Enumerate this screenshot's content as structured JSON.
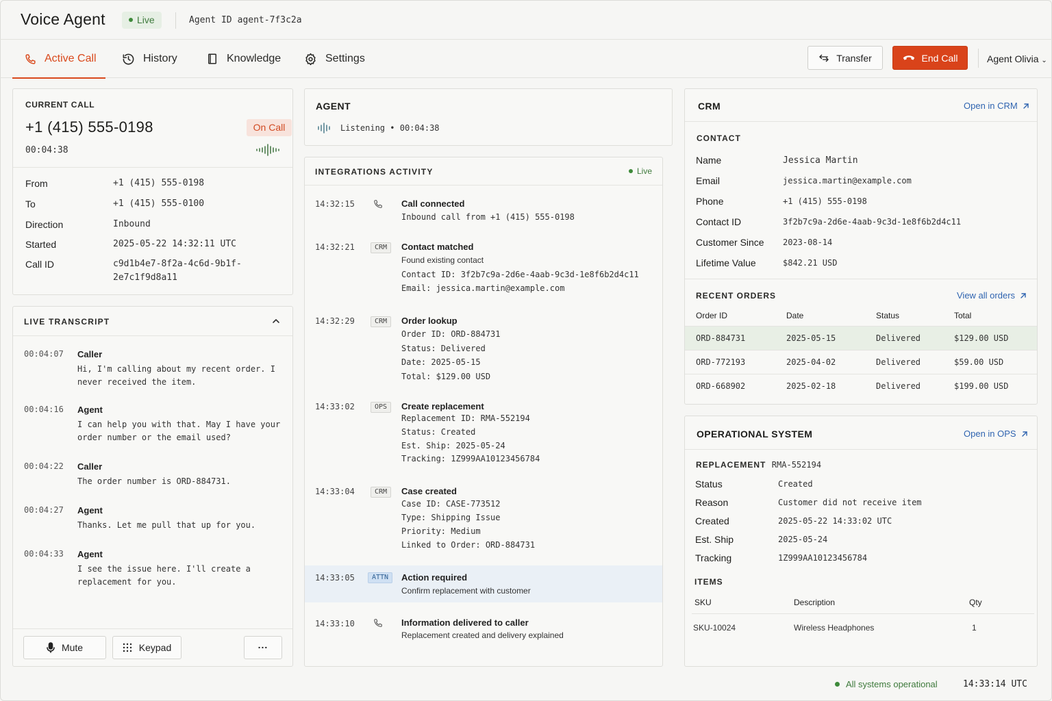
{
  "header": {
    "title": "Voice Agent",
    "live_label": "Live",
    "agent_id_label": "Agent ID",
    "agent_id": "agent-7f3c2a"
  },
  "nav": {
    "tabs": [
      {
        "label": "Active Call",
        "icon": "phone-icon",
        "active": true
      },
      {
        "label": "History",
        "icon": "history-icon"
      },
      {
        "label": "Knowledge",
        "icon": "book-icon"
      },
      {
        "label": "Settings",
        "icon": "gear-icon"
      }
    ],
    "transfer_label": "Transfer",
    "end_call_label": "End Call",
    "user_label": "Agent Olivia"
  },
  "current_call": {
    "section_label": "CURRENT CALL",
    "number": "+1 (415) 555-0198",
    "status": "On Call",
    "timer": "00:04:38",
    "fields": [
      {
        "key": "From",
        "value": "+1 (415) 555-0198"
      },
      {
        "key": "To",
        "value": "+1 (415) 555-0100"
      },
      {
        "key": "Direction",
        "value": "Inbound"
      },
      {
        "key": "Started",
        "value": "2025-05-22 14:32:11 UTC"
      },
      {
        "key": "Call ID",
        "value": "c9d1b4e7-8f2a-4c6d-9b1f-",
        "value2": "2e7c1f9d8a11"
      }
    ]
  },
  "transcript": {
    "section_label": "LIVE TRANSCRIPT",
    "entries": [
      {
        "time": "00:04:07",
        "speaker": "Caller",
        "text": "Hi, I'm calling about my recent order. I never received the item."
      },
      {
        "time": "00:04:16",
        "speaker": "Agent",
        "text": "I can help you with that. May I have your order number or the email used?"
      },
      {
        "time": "00:04:22",
        "speaker": "Caller",
        "text": "The order number is ORD-884731."
      },
      {
        "time": "00:04:27",
        "speaker": "Agent",
        "text": "Thanks. Let me pull that up for you."
      },
      {
        "time": "00:04:33",
        "speaker": "Agent",
        "text": "I see the issue here. I'll create a replacement for you."
      }
    ],
    "mute_label": "Mute",
    "keypad_label": "Keypad",
    "more_label": "..."
  },
  "agent": {
    "section_label": "AGENT",
    "state": "Listening",
    "separator": "•",
    "timer": "00:04:38"
  },
  "activity": {
    "section_label": "INTEGRATIONS ACTIVITY",
    "live_label": "Live",
    "items": [
      {
        "time": "14:32:15",
        "badge": "",
        "icon": "phone-icon",
        "title": "Call connected",
        "lines": [
          "Inbound call from +1 (415) 555-0198"
        ]
      },
      {
        "time": "14:32:21",
        "badge": "CRM",
        "title": "Contact matched",
        "lines": [
          "Found existing contact",
          "Contact ID:  3f2b7c9a-2d6e-4aab-9c3d-1e8f6b2d4c11",
          "Email:  jessica.martin@example.com"
        ]
      },
      {
        "time": "14:32:29",
        "badge": "CRM",
        "title": "Order lookup",
        "lines": [
          "Order ID:  ORD-884731",
          "Status:  Delivered",
          "Date:  2025-05-15",
          "Total:  $129.00 USD"
        ]
      },
      {
        "time": "14:33:02",
        "badge": "OPS",
        "title": "Create replacement",
        "lines": [
          "Replacement ID:  RMA-552194",
          "Status:  Created",
          "Est. Ship:  2025-05-24",
          "Tracking:  1Z999AA10123456784"
        ]
      },
      {
        "time": "14:33:04",
        "badge": "CRM",
        "title": "Case created",
        "lines": [
          "Case ID:  CASE-773512",
          "Type:  Shipping Issue",
          "Priority:  Medium",
          "Linked to Order:  ORD-884731"
        ]
      },
      {
        "time": "14:33:05",
        "badge": "ATTN",
        "title": "Action required",
        "lines": [
          "Confirm replacement with customer"
        ]
      },
      {
        "time": "14:33:10",
        "badge": "",
        "icon": "phone-icon",
        "title": "Information delivered to caller",
        "lines": [
          "Replacement created and delivery explained"
        ]
      }
    ]
  },
  "crm": {
    "section_label": "CRM",
    "open_label": "Open in CRM",
    "contact_label": "CONTACT",
    "contact": [
      {
        "key": "Name",
        "value": "Jessica Martin"
      },
      {
        "key": "Email",
        "value": "jessica.martin@example.com"
      },
      {
        "key": "Phone",
        "value": "+1 (415) 555-0198"
      },
      {
        "key": "Contact ID",
        "value": "3f2b7c9a-2d6e-4aab-9c3d-1e8f6b2d4c11"
      },
      {
        "key": "Customer Since",
        "value": "2023-08-14"
      },
      {
        "key": "Lifetime Value",
        "value": "$842.21 USD"
      }
    ],
    "orders_label": "RECENT ORDERS",
    "view_all_label": "View all orders",
    "order_columns": [
      "Order ID",
      "Date",
      "Status",
      "Total"
    ],
    "orders": [
      {
        "id": "ORD-884731",
        "date": "2025-05-15",
        "status": "Delivered",
        "total": "$129.00 USD"
      },
      {
        "id": "ORD-772193",
        "date": "2025-04-02",
        "status": "Delivered",
        "total": "$59.00 USD"
      },
      {
        "id": "ORD-668902",
        "date": "2025-02-18",
        "status": "Delivered",
        "total": "$199.00 USD"
      }
    ]
  },
  "ops": {
    "section_label": "OPERATIONAL SYSTEM",
    "open_label": "Open in OPS",
    "replacement_label": "REPLACEMENT",
    "replacement_id": "RMA-552194",
    "fields": [
      {
        "key": "Status",
        "value": "Created"
      },
      {
        "key": "Reason",
        "value": "Customer did not receive item"
      },
      {
        "key": "Created",
        "value": "2025-05-22 14:33:02 UTC"
      },
      {
        "key": "Est. Ship",
        "value": "2025-05-24"
      },
      {
        "key": "Tracking",
        "value": "1Z999AA10123456784"
      }
    ],
    "items_label": "ITEMS",
    "item_columns": [
      "SKU",
      "Description",
      "Qty"
    ],
    "items": [
      {
        "sku": "SKU-10024",
        "description": "Wireless Headphones",
        "qty": "1"
      }
    ]
  },
  "footer": {
    "status": "All systems operational",
    "clock": "14:33:14 UTC"
  },
  "colors": {
    "accent": "#d9491c",
    "link": "#2f64b0",
    "live_green": "#3e7a3c"
  }
}
